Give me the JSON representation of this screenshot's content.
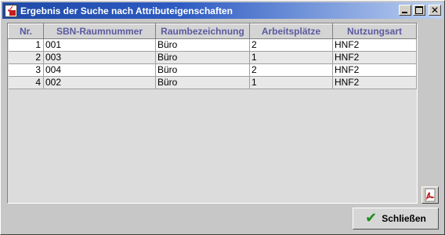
{
  "window": {
    "title": "Ergebnis der Suche nach Attributeigenschaften",
    "buttons": {
      "minimize": "_",
      "maximize": "□",
      "close": "✕"
    }
  },
  "table": {
    "columns": [
      "Nr.",
      "SBN-Raumnummer",
      "Raumbezeichnung",
      "Arbeitsplätze",
      "Nutzungsart"
    ],
    "rows": [
      [
        "1",
        "001",
        "Büro",
        "2",
        "HNF2"
      ],
      [
        "2",
        "003",
        "Büro",
        "1",
        "HNF2"
      ],
      [
        "3",
        "004",
        "Büro",
        "2",
        "HNF2"
      ],
      [
        "4",
        "002",
        "Büro",
        "1",
        "HNF2"
      ]
    ]
  },
  "footer": {
    "pdf_icon": "pdf-export-icon",
    "close_label": "Schließen",
    "close_icon": "green-check-icon"
  },
  "colors": {
    "titlebar_start": "#1f4aa8",
    "header_text": "#5a5aa0",
    "check_green": "#1e8c1e",
    "pdf_red": "#c41e1e"
  }
}
